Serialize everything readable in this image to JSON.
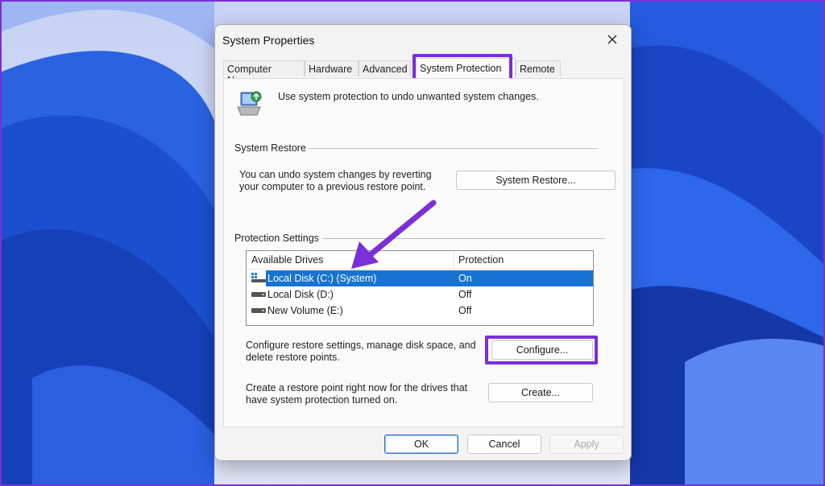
{
  "dialog": {
    "title": "System Properties",
    "tabs": [
      "Computer Name",
      "Hardware",
      "Advanced",
      "System Protection",
      "Remote"
    ],
    "active_tab": "System Protection",
    "intro": "Use system protection to undo unwanted system changes.",
    "system_restore": {
      "group_label": "System Restore",
      "description_line1": "You can undo system changes by reverting",
      "description_line2": "your computer to a previous restore point.",
      "button": "System Restore..."
    },
    "protection": {
      "group_label": "Protection Settings",
      "columns": [
        "Available Drives",
        "Protection"
      ],
      "drives": [
        {
          "name": "Local Disk (C:) (System)",
          "protection": "On",
          "selected": true,
          "icon": "system-drive-icon"
        },
        {
          "name": "Local Disk (D:)",
          "protection": "Off",
          "selected": false,
          "icon": "drive-icon"
        },
        {
          "name": "New Volume (E:)",
          "protection": "Off",
          "selected": false,
          "icon": "drive-icon"
        }
      ],
      "configure_text_line1": "Configure restore settings, manage disk space, and",
      "configure_text_line2": "delete restore points.",
      "configure_button": "Configure...",
      "create_text_line1": "Create a restore point right now for the drives that",
      "create_text_line2": "have system protection turned on.",
      "create_button": "Create..."
    },
    "buttons": {
      "ok": "OK",
      "cancel": "Cancel",
      "apply": "Apply"
    }
  },
  "colors": {
    "highlight": "#7b2fd6",
    "selection": "#1673d1",
    "wallpaper": "#1f4fd8"
  }
}
